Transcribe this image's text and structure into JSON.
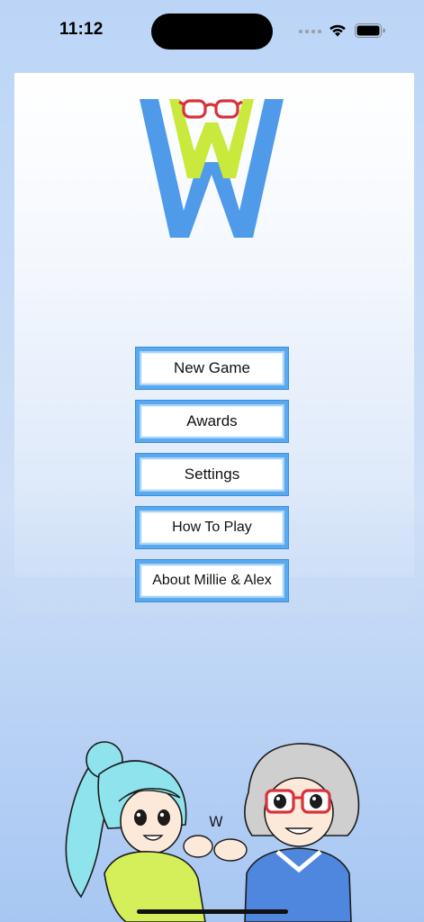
{
  "status_bar": {
    "time": "11:12"
  },
  "menu": {
    "buttons": [
      {
        "label": "New Game"
      },
      {
        "label": "Awards"
      },
      {
        "label": "Settings"
      },
      {
        "label": "How To Play"
      },
      {
        "label": "About Millie & Alex"
      }
    ]
  },
  "colors": {
    "accent_blue": "#5aa8ee",
    "logo_blue": "#4f9bea",
    "logo_lime": "#c9ea3c",
    "glasses_red": "#d8323a"
  },
  "icons": [
    "wifi-icon",
    "battery-icon",
    "signal-icon",
    "logo-w-icon"
  ]
}
